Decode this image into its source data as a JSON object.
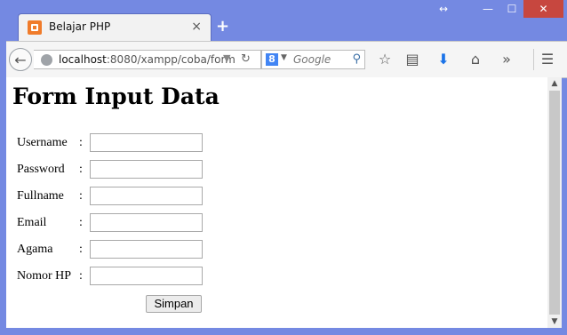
{
  "window": {
    "controls": {
      "resize": "↔",
      "minimize": "—",
      "maximize": "☐",
      "close": "✕"
    }
  },
  "tab": {
    "title": "Belajar PHP",
    "close": "×",
    "new_tab": "+"
  },
  "navbar": {
    "url_host": "localhost",
    "url_path": ":8080/xampp/coba/form",
    "search_placeholder": "Google"
  },
  "page": {
    "heading": "Form Input Data",
    "fields": [
      {
        "label": "Username",
        "value": ""
      },
      {
        "label": "Password",
        "value": ""
      },
      {
        "label": "Fullname",
        "value": ""
      },
      {
        "label": "Email",
        "value": ""
      },
      {
        "label": "Agama",
        "value": ""
      },
      {
        "label": "Nomor HP",
        "value": ""
      }
    ],
    "colon": ":",
    "submit_label": "Simpan"
  },
  "colors": {
    "titlebar": "#7489e2",
    "close_button": "#c7473f",
    "download_arrow": "#1a73e8"
  }
}
